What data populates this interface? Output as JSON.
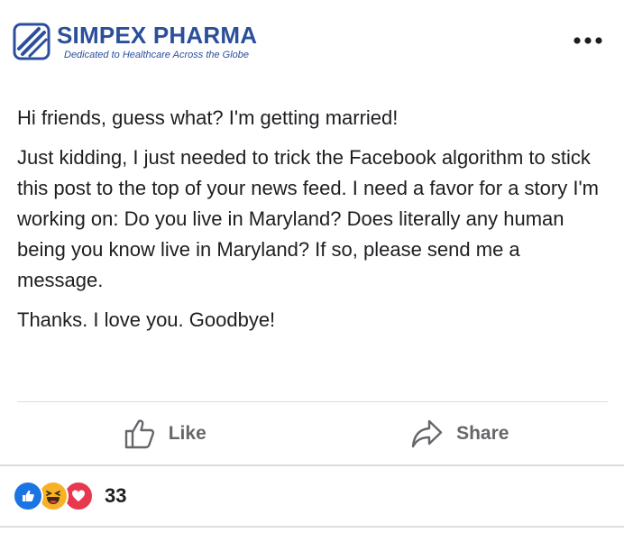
{
  "page": {
    "brand_name": "SIMPEX PHARMA",
    "tagline": "Dedicated to Healthcare Across the Globe"
  },
  "post": {
    "paragraphs": [
      "Hi friends, guess what? I'm getting married!",
      "Just kidding, I just needed to trick the Facebook algorithm to stick this post to the top of your news feed. I need a favor for a story I'm working on: Do you live in Maryland? Does literally any human being you know live in Maryland? If so, please send me a message.",
      "Thanks. I love you. Goodbye!"
    ]
  },
  "actions": {
    "like_label": "Like",
    "share_label": "Share"
  },
  "reactions": {
    "icons": [
      "like-icon",
      "haha-icon",
      "love-icon"
    ],
    "count": "33"
  },
  "colors": {
    "brand": "#2b4f9b",
    "text": "#1c1e21",
    "muted": "#65676b",
    "like_blue": "#1b74e4",
    "haha_yellow": "#f7b125",
    "love_red": "#e8384f",
    "divider": "#dadde1"
  }
}
